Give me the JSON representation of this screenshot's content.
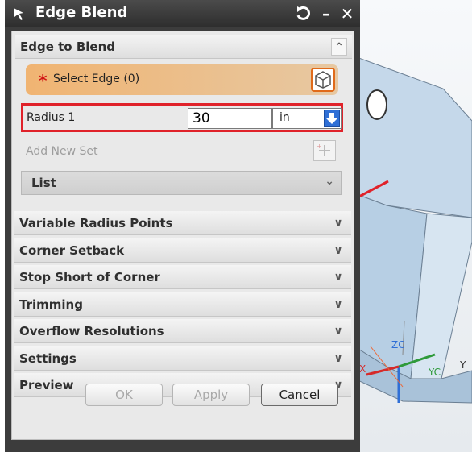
{
  "dialog": {
    "title": "Edge Blend",
    "edge_to_blend": {
      "header": "Edge to Blend",
      "select_edge_label": "Select Edge (0)",
      "radius_label": "Radius 1",
      "radius_value": "30",
      "unit": "in",
      "add_new_set_label": "Add New Set",
      "list_label": "List"
    },
    "sections": [
      "Variable Radius Points",
      "Corner Setback",
      "Stop Short of Corner",
      "Trimming",
      "Overflow Resolutions",
      "Settings",
      "Preview"
    ],
    "buttons": {
      "ok": "OK",
      "apply": "Apply",
      "cancel": "Cancel"
    }
  },
  "viewport": {
    "axis_labels": {
      "zc": "ZC",
      "yc": "YC",
      "y": "Y",
      "x": "X"
    }
  },
  "colors": {
    "titlebar": "#3a3a3a",
    "select_edge_gradient_start": "#f0b472",
    "highlight_red": "#e0222a",
    "dropdown_blue": "#2f6fd6",
    "part_blue": "#bcd3e8"
  }
}
